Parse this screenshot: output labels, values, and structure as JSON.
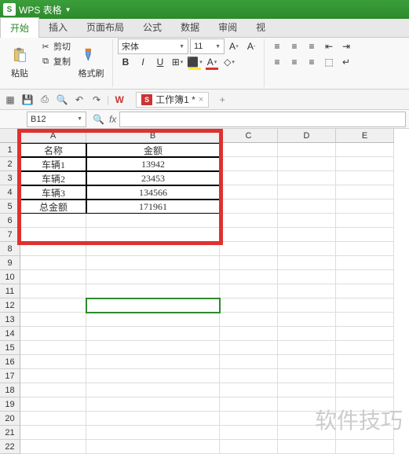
{
  "app": {
    "name": "WPS 表格",
    "logo_text": "S"
  },
  "menu": {
    "tabs": [
      "开始",
      "插入",
      "页面布局",
      "公式",
      "数据",
      "审阅",
      "视"
    ],
    "active": 0
  },
  "ribbon": {
    "paste": "粘贴",
    "cut": "剪切",
    "copy": "复制",
    "fmtpaint": "格式刷",
    "font_name": "宋体",
    "font_size": "11"
  },
  "doc_tab": {
    "label": "工作簿1 *"
  },
  "namebox": "B12",
  "columns": [
    {
      "letter": "A",
      "width": 84
    },
    {
      "letter": "B",
      "width": 170
    },
    {
      "letter": "C",
      "width": 74
    },
    {
      "letter": "D",
      "width": 74
    },
    {
      "letter": "E",
      "width": 74
    }
  ],
  "row_count": 22,
  "data_cells": {
    "r1": {
      "A": "名称",
      "B": "金额"
    },
    "r2": {
      "A": "车辆1",
      "B": "13942"
    },
    "r3": {
      "A": "车辆2",
      "B": "23453"
    },
    "r4": {
      "A": "车辆3",
      "B": "134566"
    },
    "r5": {
      "A": "总金额",
      "B": "171961"
    }
  },
  "selected_cell": {
    "row": 12,
    "col": "B"
  },
  "watermark": "软件技巧"
}
